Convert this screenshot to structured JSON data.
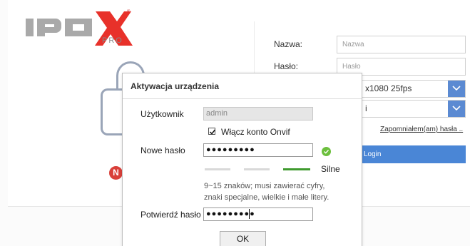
{
  "logo": {
    "text": "IPOX",
    "sub": "PRO",
    "registered": "®"
  },
  "badge": {
    "letter": "N"
  },
  "login_form": {
    "name_label": "Nazwa:",
    "name_placeholder": "Nazwa",
    "password_label": "Hasło:",
    "password_placeholder": "Hasło",
    "stream_value": "x1080 25fps",
    "second_select_value": "i",
    "forgot_link": "Zapomniałem(am) hasła ..",
    "login_button": "Login"
  },
  "dialog": {
    "title": "Aktywacja urządzenia",
    "user_label": "Użytkownik",
    "user_value": "admin",
    "onvif_checkbox_label": "Włącz konto Onvif",
    "onvif_checked": true,
    "new_password_label": "Nowe hasło",
    "new_password_value": "●●●●●●●●●",
    "strength_label": "Silne",
    "hint_line1": "9~15 znaków; musi zawierać cyfry,",
    "hint_line2": "znaki specjalne, wielkie i małe litery.",
    "confirm_password_label": "Potwierdź hasło",
    "confirm_password_value": "●●●●●●●●●",
    "ok_button": "OK"
  },
  "colors": {
    "accent_blue": "#4a86d6",
    "strength_strong": "#3f9a2e",
    "logo_red": "#e8312a",
    "logo_gray": "#a9a9a9"
  }
}
